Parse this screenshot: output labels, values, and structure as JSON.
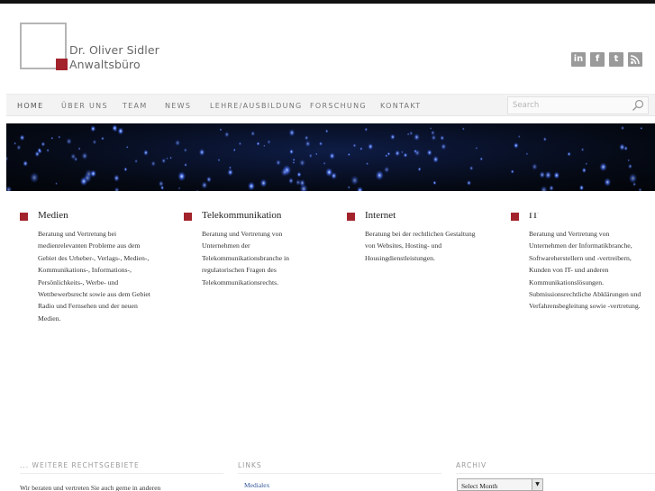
{
  "brand": {
    "name_line1": "Dr. Oliver Sidler",
    "name_line2": "Anwaltsbüro",
    "accent_color": "#a3232c"
  },
  "social": [
    {
      "icon": "linkedin-icon",
      "glyph": "in"
    },
    {
      "icon": "facebook-icon",
      "glyph": "f"
    },
    {
      "icon": "twitter-icon",
      "glyph": "t"
    },
    {
      "icon": "rss-icon",
      "glyph": ")"
    }
  ],
  "nav": {
    "items": [
      "HOME",
      "ÜBER UNS",
      "TEAM",
      "NEWS",
      "LEHRE/AUSBILDUNG",
      "FORSCHUNG",
      "KONTAKT"
    ],
    "active": "HOME",
    "search_placeholder": "Search"
  },
  "services": [
    {
      "title": "Medien",
      "lines": [
        "Beratung und Vertretung bei",
        "medienrelevanten Probleme aus dem",
        "Gebiet des Urheber-, Verlags-, Medien-,",
        "Kommunikations-, Informations-,",
        "Persönlichkeits-, Werbe- und",
        "Wettbewerbsrecht sowie aus dem Gebiet",
        "Radio und Fernsehen und der neuen",
        "Medien."
      ]
    },
    {
      "title": "Telekommunikation",
      "lines": [
        "Beratung und Vertretung von",
        "Unternehmen der",
        "Telekommunikationsbranche in",
        "regulatorischen Fragen des",
        "Telekommunikationsrechts."
      ]
    },
    {
      "title": "Internet",
      "lines": [
        "Beratung bei der rechtlichen Gestaltung",
        "von Websites, Hosting- und",
        "Housingdienstleistungen."
      ]
    },
    {
      "title": "IT",
      "lines": [
        "Beratung und Vertretung von",
        "Unternehmen der Informatikbranche,",
        "Softwareherstellern und -vertreibern,",
        "Kunden von IT- und anderen",
        "Kommunikationslösungen.",
        "Submissionsrechtliche Abklärungen und",
        "Verfahrensbegleitung sowie -vertretung."
      ]
    }
  ],
  "footer": {
    "more_title": "... WEITERE RECHTSGEBIETE",
    "more_text": "Wir beraten und vertreten Sie auch gerne in anderen",
    "links_title": "LINKS",
    "links": [
      "Medialex"
    ],
    "archive_title": "ARCHIV",
    "archive_select": "Select Month"
  }
}
